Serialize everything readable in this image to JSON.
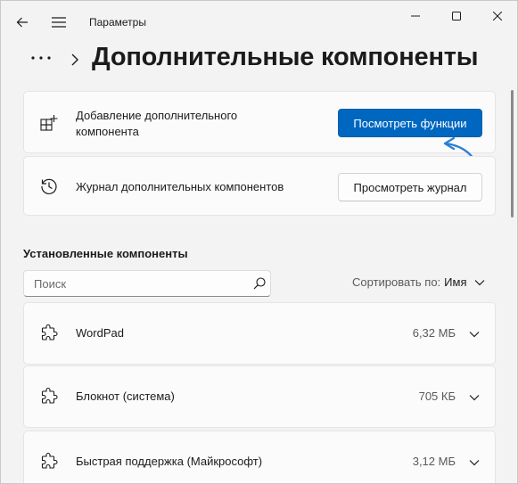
{
  "window": {
    "title": "Параметры"
  },
  "breadcrumb": {
    "more_label": "•••",
    "page_title": "Дополнительные компоненты"
  },
  "add_card": {
    "label": "Добавление дополнительного компонента",
    "button_label": "Посмотреть функции",
    "icon": "add-feature-icon"
  },
  "history_card": {
    "label": "Журнал дополнительных компонентов",
    "button_label": "Просмотреть журнал",
    "icon": "history-icon"
  },
  "installed": {
    "title": "Установленные компоненты",
    "search_placeholder": "Поиск",
    "sort_label": "Сортировать по:",
    "sort_value": "Имя",
    "items": [
      {
        "name": "WordPad",
        "size": "6,32 МБ",
        "icon": "puzzle-icon"
      },
      {
        "name": "Блокнот (система)",
        "size": "705 КБ",
        "icon": "puzzle-icon"
      },
      {
        "name": "Быстрая поддержка (Майкрософт)",
        "size": "3,12 МБ",
        "icon": "puzzle-icon"
      }
    ]
  },
  "colors": {
    "accent": "#0067c0",
    "annotation_arrow": "#2a7fd4",
    "background": "#f3f3f3",
    "card": "#fbfbfb"
  }
}
